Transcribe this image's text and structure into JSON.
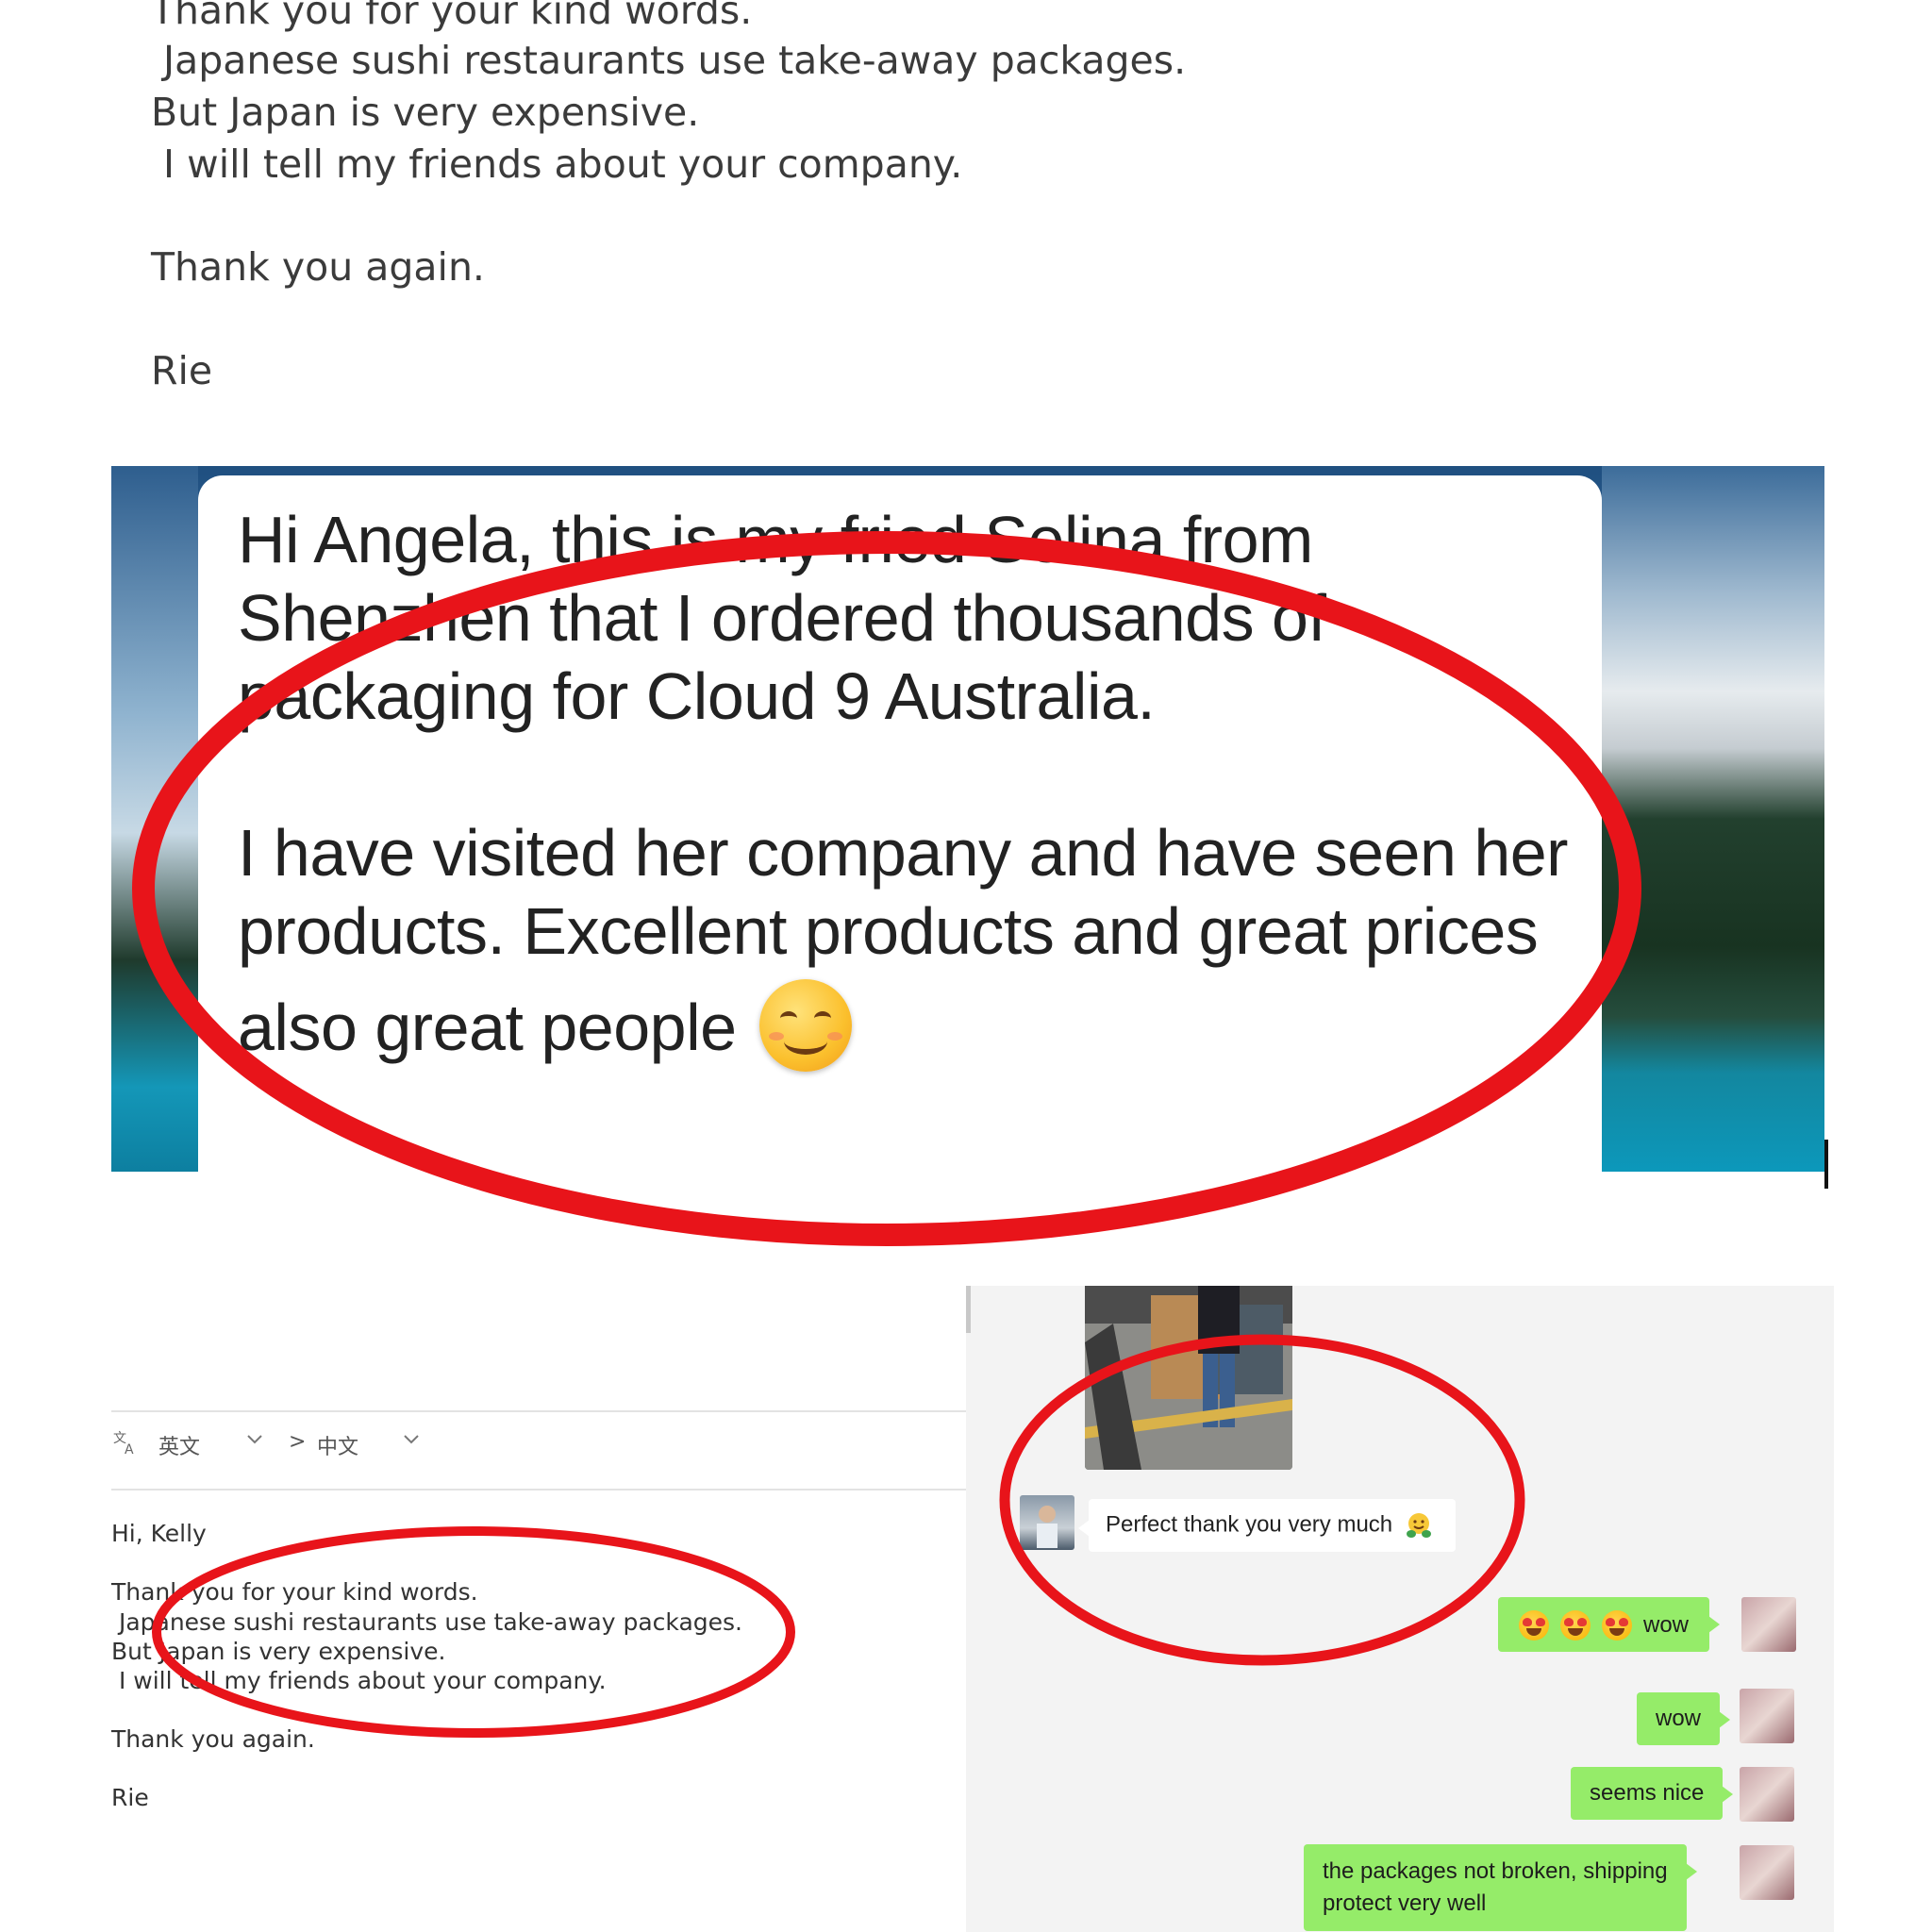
{
  "top_email": {
    "lines": [
      "Thank you for your kind words.",
      " Japanese sushi restaurants use take-away packages.",
      "But Japan is very expensive.",
      " I will tell my friends about your company.",
      "Thank you again.",
      "Rie"
    ]
  },
  "banner_message": {
    "lines": [
      "Hi Angela, this is my fried Selina from",
      "Shenzhen that I ordered thousands of",
      "packaging for Cloud 9 Australia.",
      "I have visited her company and have seen her",
      "products. Excellent products and great prices",
      "also great people"
    ],
    "emoji": "smiling-face-icon"
  },
  "email_panel": {
    "translate_icon": "translate-icon",
    "source_language": "英文",
    "arrow": ">",
    "target_language": "中文",
    "greeting": "Hi, Kelly",
    "body_lines": [
      "Thank you for your kind words.",
      " Japanese sushi restaurants use take-away packages.",
      "But Japan is very expensive.",
      " I will tell my friends about your company."
    ],
    "closing": "Thank you again.",
    "signature": "Rie"
  },
  "chat": {
    "incoming": [
      {
        "text": "Perfect thank you very much",
        "emoji": "hugging-face-icon"
      }
    ],
    "outgoing": [
      {
        "emojis": [
          "star-struck-face-icon",
          "star-struck-face-icon",
          "star-struck-face-icon"
        ],
        "text": "wow"
      },
      {
        "text": "wow"
      },
      {
        "text": "seems nice"
      },
      {
        "lines": [
          "the packages not broken, shipping",
          "protect very well"
        ]
      }
    ]
  },
  "colors": {
    "highlight_circle": "#e8141a",
    "chat_outgoing_bubble": "#95ec69",
    "chat_background": "#f3f3f3"
  }
}
